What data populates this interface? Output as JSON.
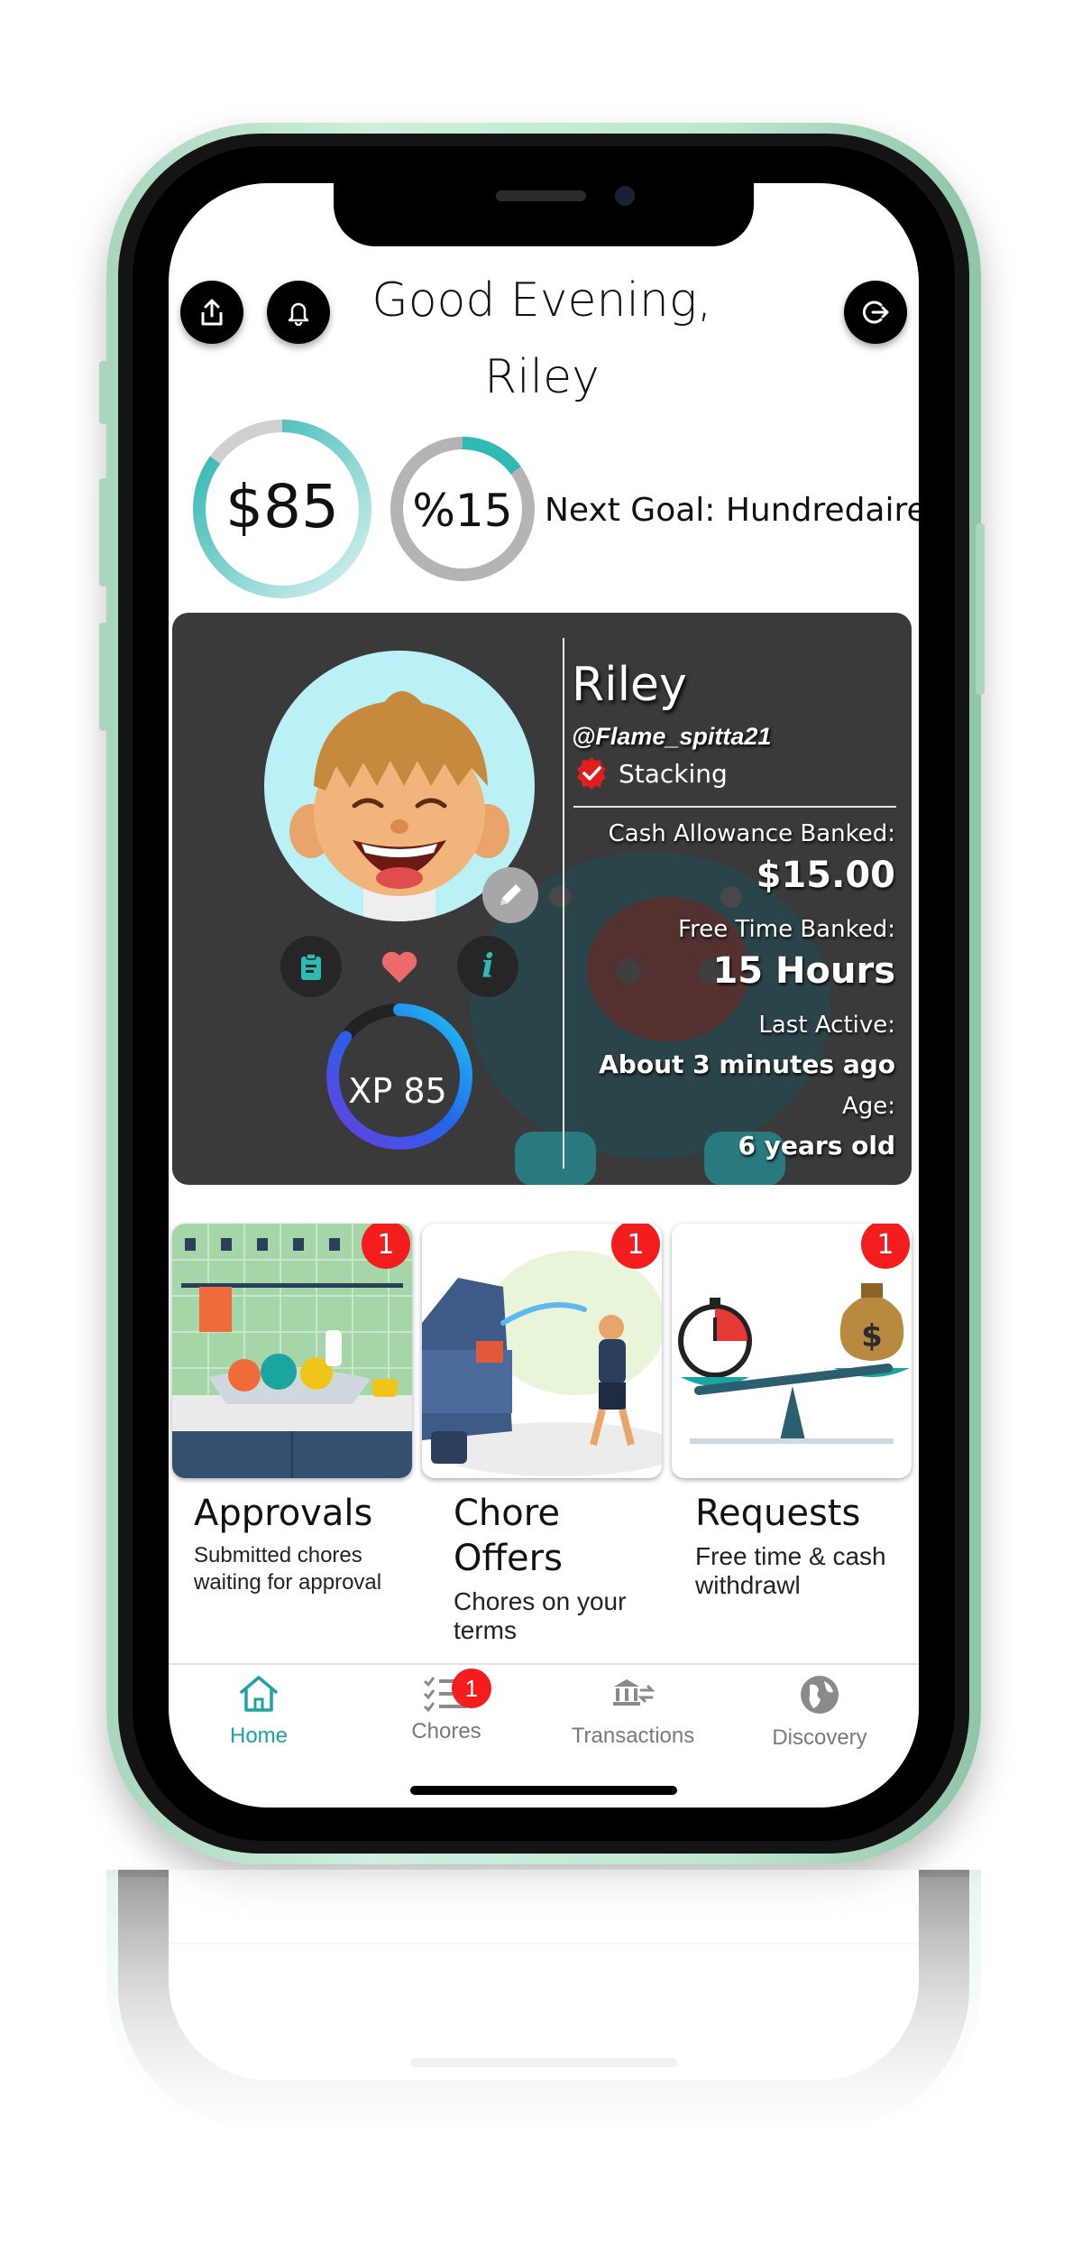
{
  "header": {
    "greeting_line1": "Good Evening,",
    "greeting_line2": "Riley"
  },
  "rings": {
    "balance": {
      "label": "$85",
      "progress": 0.85
    },
    "percent": {
      "label": "%15",
      "progress": 0.15
    },
    "next_goal": "Next Goal: Hundredaire"
  },
  "profile": {
    "name": "Riley",
    "handle": "@Flame_spitta21",
    "status": "Stacking",
    "xp_label": "XP 85",
    "xp_progress": 0.85,
    "cash_label": "Cash Allowance Banked:",
    "cash_value": "$15.00",
    "free_time_label": "Free Time Banked:",
    "free_time_value": "15 Hours",
    "last_active_label": "Last Active:",
    "last_active_value": "About 3 minutes ago",
    "age_label": "Age:",
    "age_value": "6 years old"
  },
  "tiles": [
    {
      "title": "Approvals",
      "subtitle": "Submitted chores waiting for approval",
      "badge": "1"
    },
    {
      "title": "Chore Offers",
      "subtitle": "Chores on your terms",
      "badge": "1"
    },
    {
      "title": "Requests",
      "subtitle": "Free time & cash withdrawl",
      "badge": "1"
    }
  ],
  "nav": [
    {
      "label": "Home",
      "icon": "home-icon",
      "active": true
    },
    {
      "label": "Chores",
      "icon": "checklist-icon",
      "badge": "1"
    },
    {
      "label": "Transactions",
      "icon": "bank-transfer-icon"
    },
    {
      "label": "Discovery",
      "icon": "globe-icon"
    }
  ],
  "colors": {
    "accent": "#1aa5a1",
    "badge": "#f41d1d",
    "card": "#3a3a3a",
    "phone_frame": "#a9d6bd"
  }
}
